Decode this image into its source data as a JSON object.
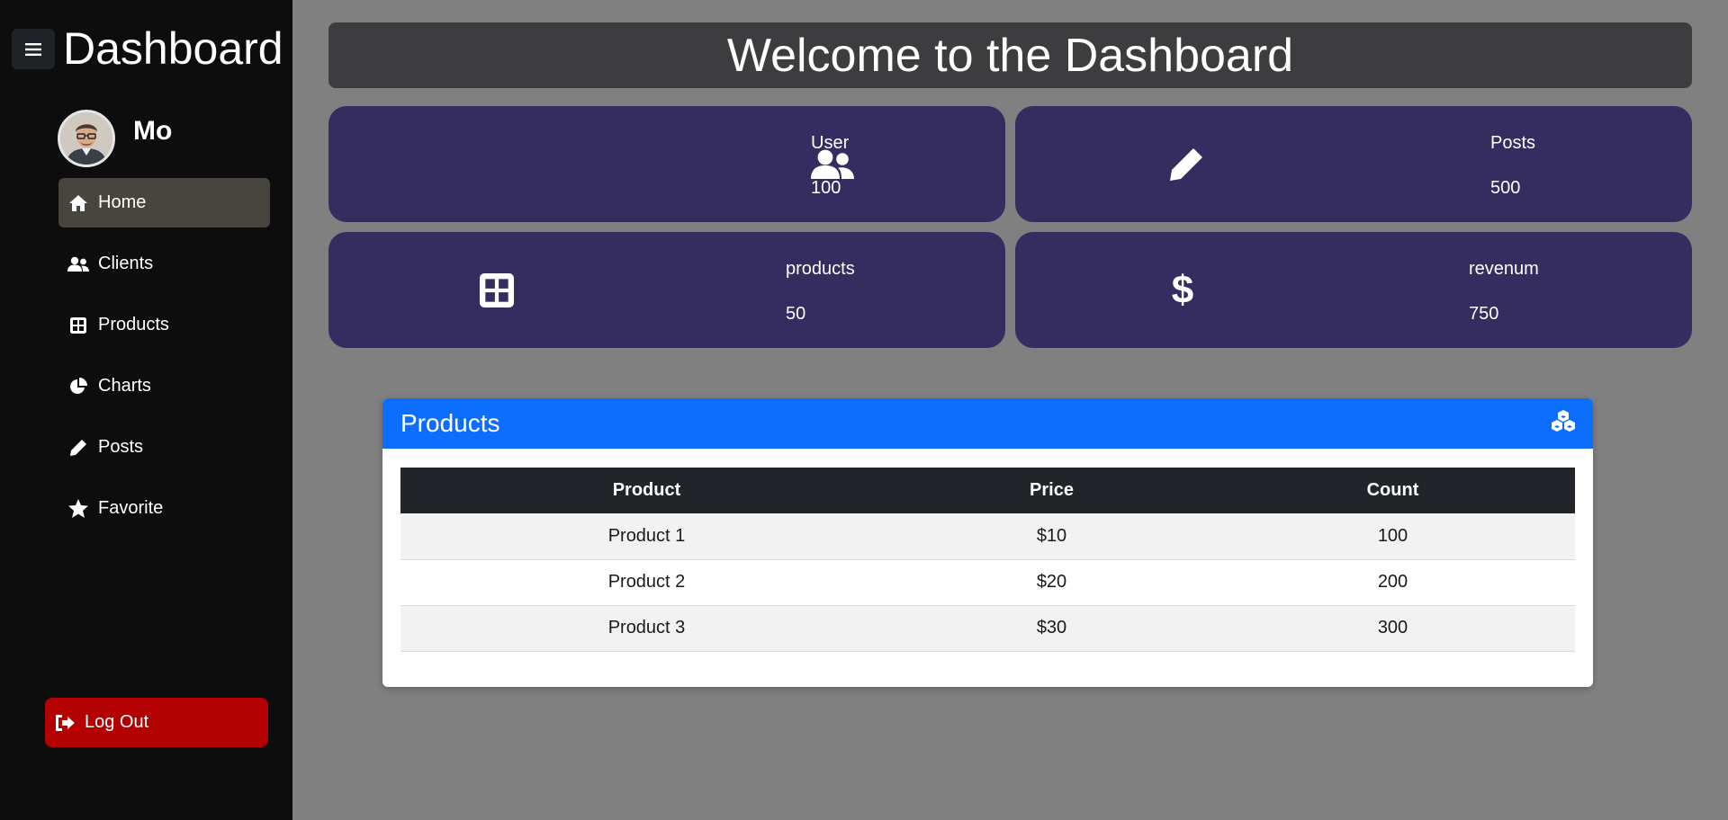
{
  "sidebar": {
    "brand": "Dashboard",
    "user_name": "Mo",
    "items": [
      {
        "label": "Home",
        "icon": "home-icon"
      },
      {
        "label": "Clients",
        "icon": "users-icon"
      },
      {
        "label": "Products",
        "icon": "table-icon"
      },
      {
        "label": "Charts",
        "icon": "pie-chart-icon"
      },
      {
        "label": "Posts",
        "icon": "pencil-icon"
      },
      {
        "label": "Favorite",
        "icon": "star-icon"
      }
    ],
    "logout_label": "Log Out"
  },
  "header": {
    "title": "Welcome to the Dashboard"
  },
  "cards": [
    {
      "label": "User",
      "value": "100",
      "icon": "users-icon"
    },
    {
      "label": "Posts",
      "value": "500",
      "icon": "pencil-icon"
    },
    {
      "label": "products",
      "value": "50",
      "icon": "table-icon"
    },
    {
      "label": "revenum",
      "value": "750",
      "icon": "dollar-icon"
    }
  ],
  "products_panel": {
    "title": "Products",
    "icon": "cubes-icon",
    "columns": [
      "Product",
      "Price",
      "Count"
    ],
    "rows": [
      [
        "Product 1",
        "$10",
        "100"
      ],
      [
        "Product 2",
        "$20",
        "200"
      ],
      [
        "Product 3",
        "$30",
        "300"
      ]
    ]
  },
  "colors": {
    "sidebar_bg": "#0d0d0d",
    "active_item": "#48453f",
    "card_bg": "#352c5f",
    "panel_header": "#0d6efd",
    "logout": "#b30000",
    "page_bg": "#808080"
  }
}
